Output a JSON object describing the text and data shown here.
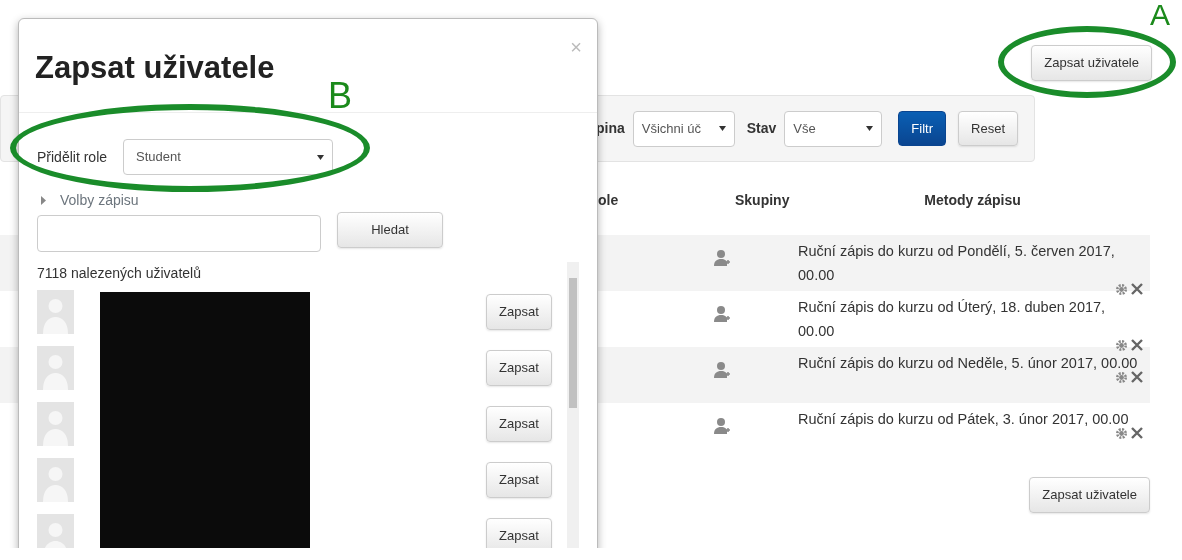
{
  "page": {
    "enroll_button_top": "Zapsat uživatele",
    "filter": {
      "group_label": "pina",
      "group_value": "Všichni úč",
      "status_label": "Stav",
      "status_value": "Vše",
      "filter_button": "Filtr",
      "reset_button": "Reset"
    },
    "table": {
      "columns": [
        "ole",
        "Skupiny",
        "Metody zápisu"
      ],
      "rows": [
        {
          "method": "Ruční zápis do kurzu od Pondělí, 5. červen 2017, 00.00"
        },
        {
          "method": "Ruční zápis do kurzu od Úterý, 18. duben 2017, 00.00"
        },
        {
          "method": "Ruční zápis do kurzu od Neděle, 5. únor 2017, 00.00"
        },
        {
          "method": "Ruční zápis do kurzu od Pátek, 3. únor 2017, 00.00"
        }
      ]
    },
    "enroll_button_bottom": "Zapsat uživatele"
  },
  "modal": {
    "title": "Zapsat uživatele",
    "close": "×",
    "role_label": "Přidělit role",
    "role_value": "Student",
    "options_toggle": "Volby zápisu",
    "search_button": "Hledat",
    "result_count": "7118 nalezených uživatelů",
    "users": [
      {
        "button": "Zapsat"
      },
      {
        "button": "Zapsat"
      },
      {
        "button": "Zapsat"
      },
      {
        "button": "Zapsat"
      },
      {
        "button": "Zapsat"
      }
    ]
  },
  "annotations": [
    {
      "label": "B"
    },
    {
      "label": "A"
    }
  ]
}
